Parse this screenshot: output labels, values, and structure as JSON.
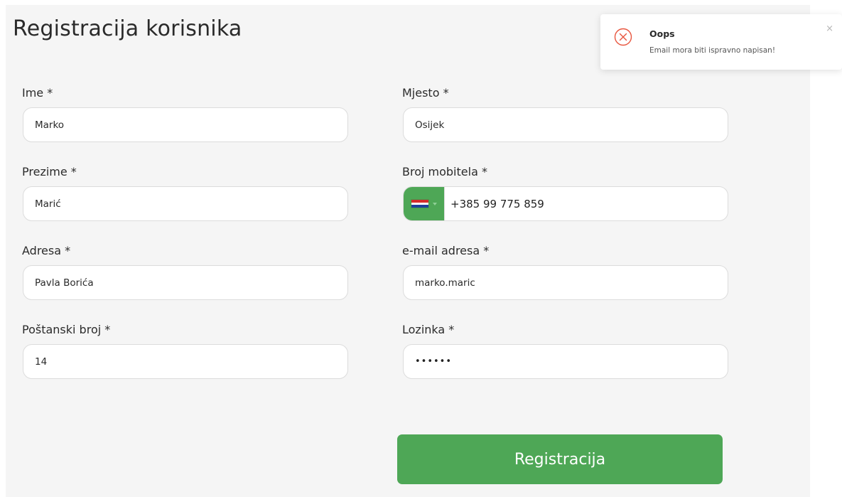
{
  "page": {
    "title": "Registracija korisnika"
  },
  "form": {
    "first_name": {
      "label": "Ime *",
      "value": "Marko"
    },
    "last_name": {
      "label": "Prezime *",
      "value": "Marić"
    },
    "address": {
      "label": "Adresa *",
      "value": "Pavla Borića"
    },
    "postal_code": {
      "label": "Poštanski broj *",
      "value": "14"
    },
    "city": {
      "label": "Mjesto *",
      "value": "Osijek"
    },
    "mobile": {
      "label": "Broj mobitela *",
      "value": "+385 99 775 859",
      "country": "hr-flag-icon"
    },
    "email": {
      "label": "e-mail adresa *",
      "value": "marko.maric"
    },
    "password": {
      "label": "Lozinka *",
      "value": "••••••"
    },
    "submit_label": "Registracija"
  },
  "toast": {
    "title": "Oops",
    "message": "Email mora biti ispravno napisan!",
    "close": "×"
  },
  "colors": {
    "accent": "#4ea756",
    "error": "#e8553e",
    "panel_bg": "#f5f5f5"
  }
}
